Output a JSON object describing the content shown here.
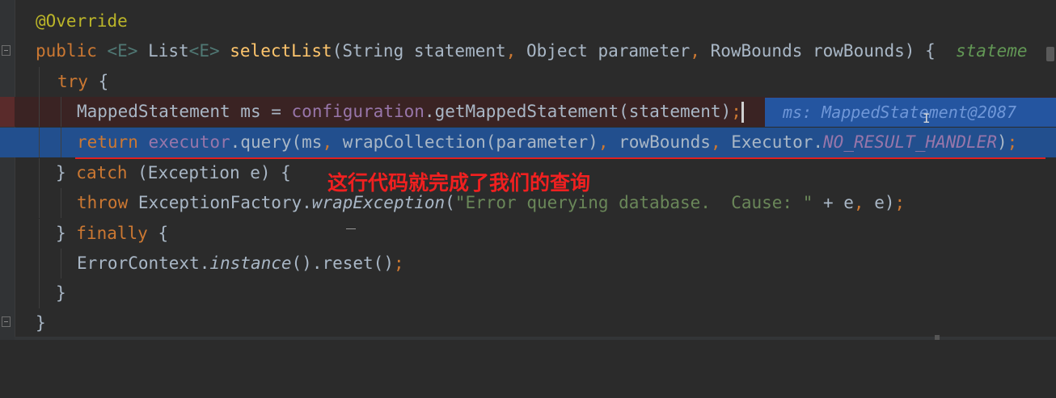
{
  "colors": {
    "background": "#2b2b2b",
    "keyword": "#cc7832",
    "annotation": "#bbb529",
    "method": "#ffc66d",
    "field": "#9876aa",
    "string": "#6a8759",
    "execution_line": "#224f8e",
    "breakpoint_line": "#3a2323",
    "callout": "#f02020"
  },
  "code": {
    "line1": {
      "annotation": "@Override"
    },
    "line2": {
      "kw_public": "public",
      "generic_open": "<E>",
      "type_list": " List",
      "generic_ret": "<E>",
      "method": "selectList",
      "paren_open": "(",
      "type_string": "String",
      "param_statement": " statement",
      "comma1": ",",
      "type_object": " Object",
      "param_parameter": " parameter",
      "comma2": ",",
      "type_rowbounds": " RowBounds",
      "param_rowbounds": " rowBounds",
      "close_brace": ") {",
      "inline_hint": "  stateme"
    },
    "line3": {
      "kw_try": "try",
      "brace": " {"
    },
    "line4": {
      "type": "MappedStatement",
      "var": " ms",
      "assign": " = ",
      "field": "configuration",
      "dot": ".",
      "method": "getMappedStatement",
      "args": "(statement)",
      "semicolon": ";",
      "debug_hint": "ms: MappedStatement@2087"
    },
    "line5": {
      "kw_return": "return",
      "field": " executor",
      "call": ".query(ms",
      "comma1": ",",
      "wrap": " wrapCollection(parameter)",
      "comma2": ",",
      "rowbounds": " rowBounds",
      "comma3": ",",
      "executor": " Executor.",
      "constant": "NO_RESULT_HANDLER",
      "close": ")",
      "semicolon": ";"
    },
    "line6": {
      "close_brace": "} ",
      "kw_catch": "catch",
      "rest": " (Exception e) {"
    },
    "line7": {
      "kw_throw": "throw",
      "factory": " ExceptionFactory.",
      "method": "wrapException",
      "paren": "(",
      "string": "\"Error querying database.  Cause: \"",
      "rest": " + e",
      "comma": ",",
      "rest2": " e)",
      "semicolon": ";"
    },
    "line8": {
      "close_brace": "} ",
      "kw_finally": "finally",
      "brace": " {"
    },
    "line9": {
      "type": "ErrorContext.",
      "method": "instance",
      "parens": "()",
      "reset": ".reset()",
      "semicolon": ";"
    },
    "line10": {
      "brace": "}"
    },
    "line11": {
      "brace": "}"
    }
  },
  "callout": {
    "text": "这行代码就完成了我们的查询"
  }
}
